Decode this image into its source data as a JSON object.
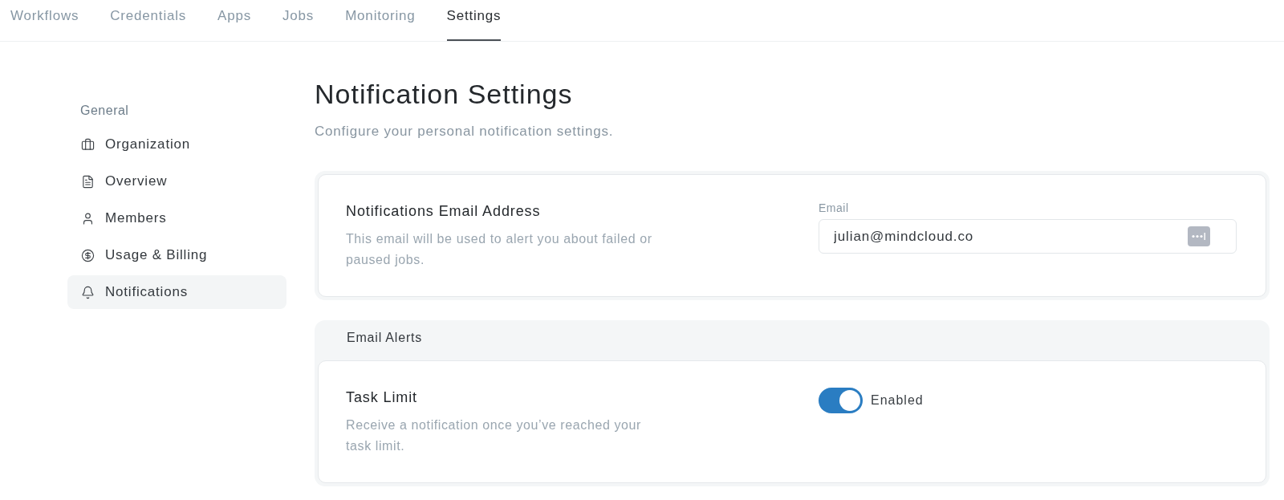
{
  "nav": {
    "tabs": [
      {
        "label": "Workflows",
        "selected": false
      },
      {
        "label": "Credentials",
        "selected": false
      },
      {
        "label": "Apps",
        "selected": false
      },
      {
        "label": "Jobs",
        "selected": false
      },
      {
        "label": "Monitoring",
        "selected": false
      },
      {
        "label": "Settings",
        "selected": true
      }
    ]
  },
  "sidebar": {
    "section": "General",
    "items": [
      {
        "label": "Organization",
        "selected": false
      },
      {
        "label": "Overview",
        "selected": false
      },
      {
        "label": "Members",
        "selected": false
      },
      {
        "label": "Usage & Billing",
        "selected": false
      },
      {
        "label": "Notifications",
        "selected": true
      }
    ]
  },
  "page": {
    "title": "Notification Settings",
    "subtitle": "Configure your personal notification settings."
  },
  "email_card": {
    "title": "Notifications Email Address",
    "description": "This email will be used to alert you about failed or paused jobs.",
    "field": {
      "label": "Email",
      "value": "julian@mindcloud.co"
    }
  },
  "email_alerts": {
    "heading": "Email Alerts",
    "items": [
      {
        "title": "Task Limit",
        "description": "Receive a notification once you’ve reached your task limit.",
        "on": true,
        "status": "Enabled"
      }
    ]
  }
}
